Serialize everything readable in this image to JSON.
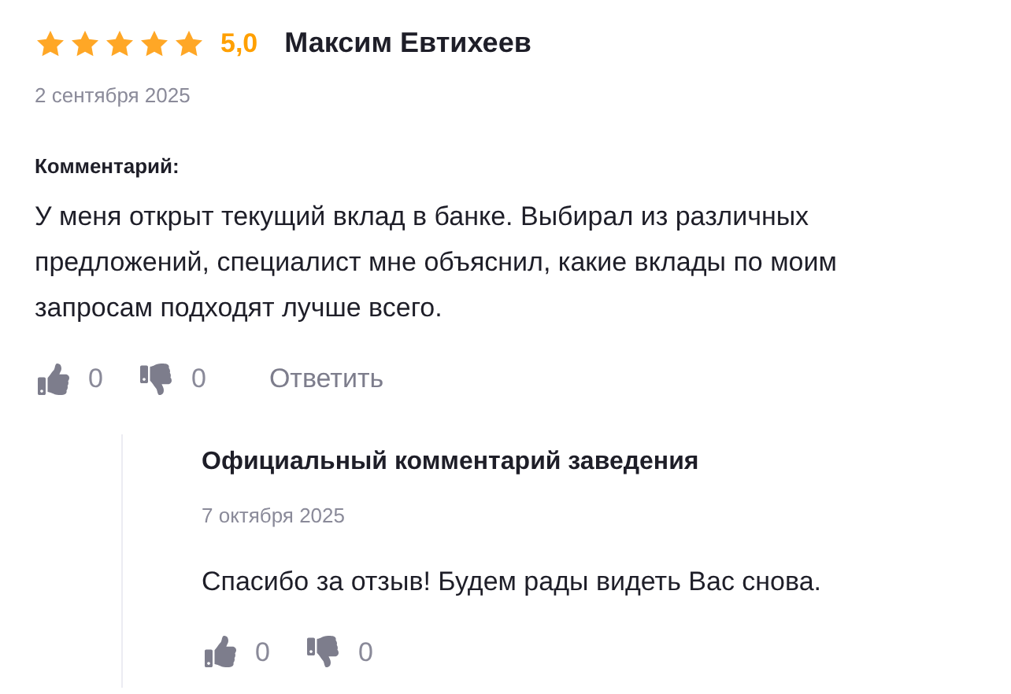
{
  "review": {
    "stars": 5,
    "rating": "5,0",
    "author": "Максим Евтихеев",
    "date": "2 сентября 2025",
    "comment_label": "Комментарий:",
    "text": "У меня открыт текущий вклад в банке. Выбирал из различных предложений, специалист мне объяснил, какие вклады по моим запросам подходят лучше всего.",
    "likes": "0",
    "dislikes": "0",
    "reply_link": "Ответить"
  },
  "official_reply": {
    "title": "Официальный комментарий заведения",
    "date": "7 октября 2025",
    "text": "Спасибо за отзыв! Будем рады видеть Вас снова.",
    "likes": "0",
    "dislikes": "0"
  }
}
